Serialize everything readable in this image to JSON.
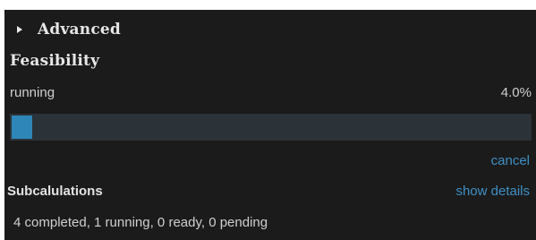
{
  "advanced": {
    "label": "Advanced",
    "icon": "triangle-right-icon"
  },
  "feasibility": {
    "title": "Feasibility",
    "status": "running",
    "percent_text": "4.0%",
    "progress_fraction": 0.04,
    "cancel_label": "cancel"
  },
  "subcalculations": {
    "title": "Subcalulations",
    "show_details_label": "show details",
    "summary": "4 completed, 1 running, 0 ready, 0 pending"
  },
  "colors": {
    "panel_bg": "#1b1b1b",
    "progress_track": "#2b3238",
    "progress_fill": "#2e86b8",
    "link": "#3f8fc4"
  }
}
